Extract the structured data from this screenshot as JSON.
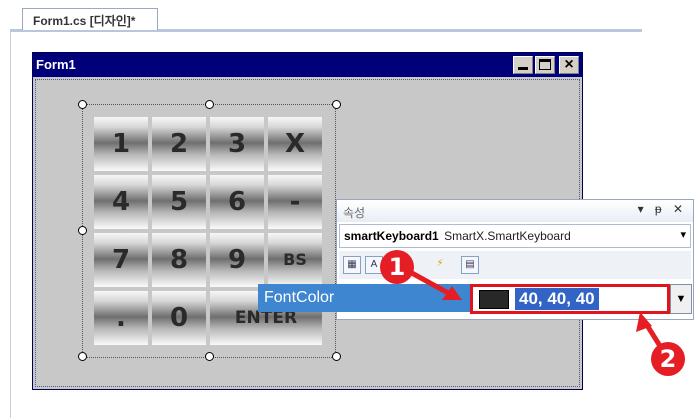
{
  "tab": {
    "label": "Form1.cs [디자인]*"
  },
  "form": {
    "title": "Form1"
  },
  "keyboard": {
    "keys": [
      "1",
      "2",
      "3",
      "X",
      "4",
      "5",
      "6",
      "-",
      "7",
      "8",
      "9",
      "BS",
      ".",
      "0",
      "ENTER"
    ]
  },
  "properties": {
    "header": "속성",
    "tools": "▾ ᵽ ✕",
    "object_name": "smartKeyboard1",
    "object_type": "SmartX.SmartKeyboard",
    "property_name": "FontColor",
    "property_value": "40, 40, 40",
    "swatch_color": "#282828"
  },
  "callouts": {
    "step1": "1",
    "step2": "2"
  },
  "colors": {
    "titlebar": "#00007a",
    "highlight": "#3f86d0",
    "callout": "#e51e25"
  }
}
